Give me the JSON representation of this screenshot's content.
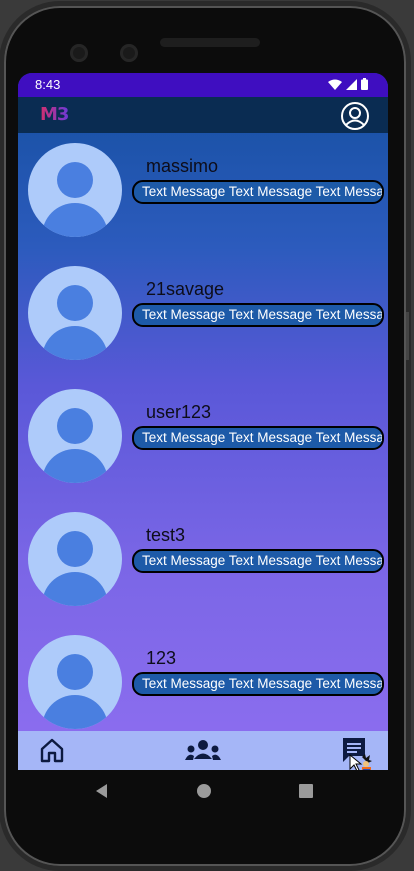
{
  "status_bar": {
    "time": "8:43"
  },
  "app_bar": {
    "logo_text": "M3",
    "profile_icon": "account-circle-icon"
  },
  "chats": [
    {
      "username": "massimo",
      "message": "Text Message Text Message Text Message"
    },
    {
      "username": "21savage",
      "message": "Text Message Text Message Text Message"
    },
    {
      "username": "user123",
      "message": "Text Message Text Message Text Message"
    },
    {
      "username": "test3",
      "message": "Text Message Text Message Text Message"
    },
    {
      "username": "123",
      "message": "Text Message Text Message Text Message"
    }
  ],
  "bottom_nav": {
    "items": [
      "home-icon",
      "groups-icon",
      "chat-icon"
    ]
  },
  "colors": {
    "status_bar": "#3f0ec0",
    "app_bar": "#0a2c52",
    "bottom_nav": "#a5b6f7",
    "avatar_bg": "#aecbfa",
    "avatar_fg": "#4a7fe0",
    "pill_bg": "#1d5aa8"
  }
}
